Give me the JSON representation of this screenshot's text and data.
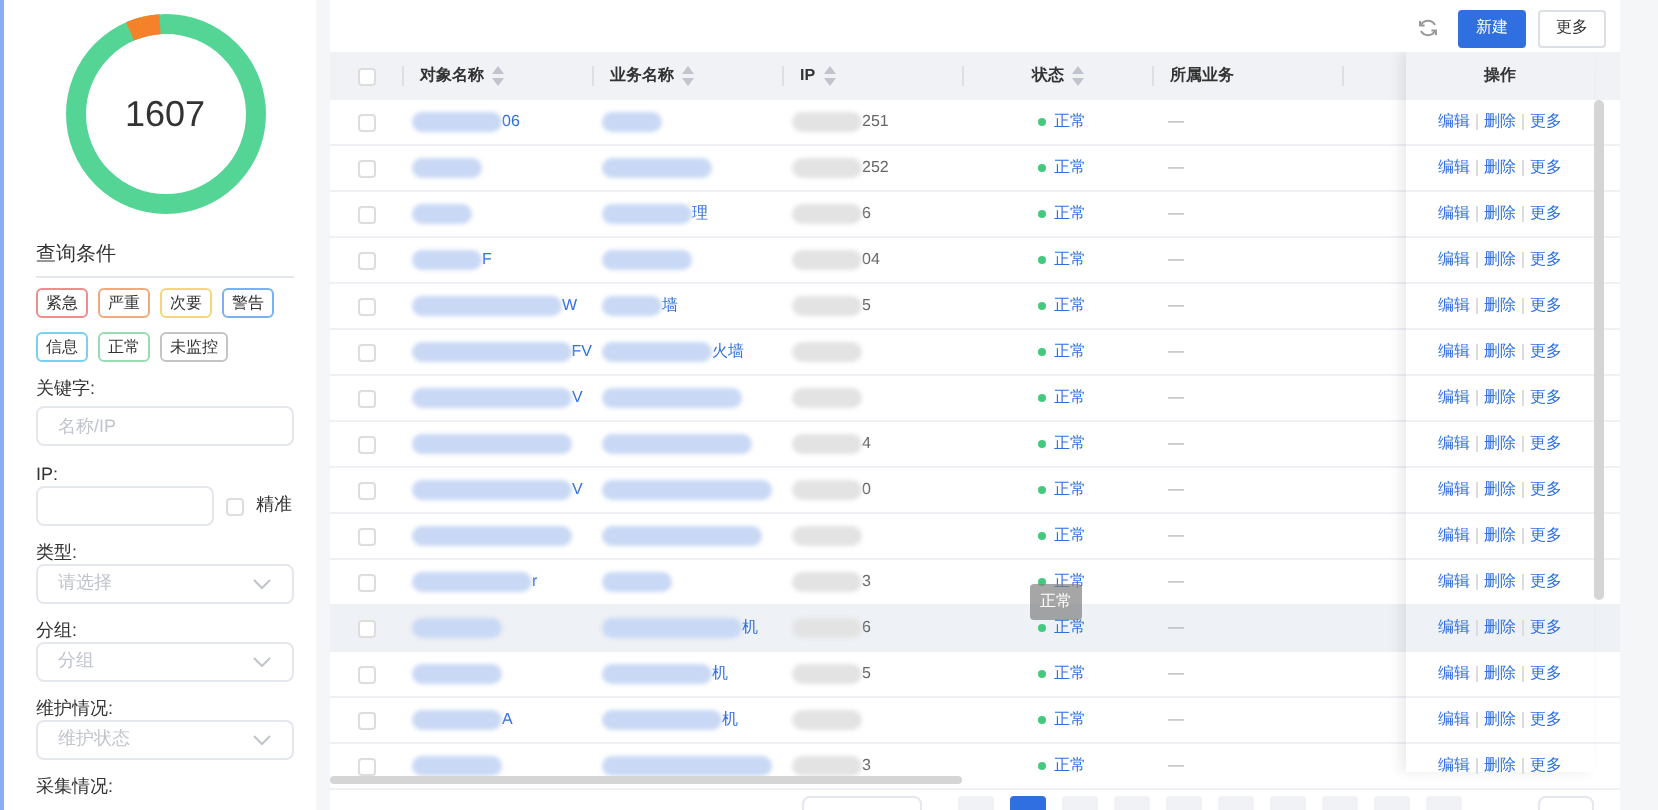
{
  "summary": {
    "total": "1607"
  },
  "filters": {
    "title": "查询条件",
    "levels": [
      {
        "label": "紧急",
        "color": "#f08c8c"
      },
      {
        "label": "严重",
        "color": "#f5a97a"
      },
      {
        "label": "次要",
        "color": "#f5d67a"
      },
      {
        "label": "警告",
        "color": "#7ab0f5"
      },
      {
        "label": "信息",
        "color": "#7ad0f0"
      },
      {
        "label": "正常",
        "color": "#9adbb4"
      },
      {
        "label": "未监控",
        "color": "#c4c4c4"
      }
    ],
    "keyword": {
      "label": "关键字:",
      "placeholder": "名称/IP"
    },
    "ip": {
      "label": "IP:",
      "exact_label": "精准",
      "checked": false
    },
    "type": {
      "label": "类型:",
      "placeholder": "请选择"
    },
    "group": {
      "label": "分组:",
      "placeholder": "分组"
    },
    "maintenance": {
      "label": "维护情况:",
      "placeholder": "维护状态"
    },
    "collection": {
      "label": "采集情况:"
    }
  },
  "toolbar": {
    "new": "新建",
    "more": "更多"
  },
  "table": {
    "columns": [
      "对象名称",
      "业务名称",
      "IP",
      "状态",
      "所属业务",
      "操作"
    ],
    "select_all": {
      "checked": false
    },
    "rows": [
      {
        "checked": false,
        "name": "06",
        "ip": "251",
        "status": "正常",
        "business": "—",
        "highlighted": false,
        "actions": [
          "编辑",
          "删除",
          "更多"
        ]
      },
      {
        "checked": false,
        "ip": "252",
        "status": "正常",
        "business": "—",
        "highlighted": false,
        "actions": [
          "编辑",
          "删除",
          "更多"
        ]
      },
      {
        "checked": false,
        "service": "理",
        "ip": "6",
        "status": "正常",
        "business": "—",
        "highlighted": false,
        "actions": [
          "编辑",
          "删除",
          "更多"
        ]
      },
      {
        "checked": false,
        "name": "F",
        "ip": "04",
        "status": "正常",
        "business": "—",
        "highlighted": false,
        "actions": [
          "编辑",
          "删除",
          "更多"
        ]
      },
      {
        "checked": false,
        "name": "W",
        "service": "墙",
        "ip": "5",
        "status": "正常",
        "business": "—",
        "highlighted": false,
        "actions": [
          "编辑",
          "删除",
          "更多"
        ]
      },
      {
        "checked": false,
        "name": "FV",
        "service": "火墙",
        "status": "正常",
        "business": "—",
        "highlighted": false,
        "actions": [
          "编辑",
          "删除",
          "更多"
        ]
      },
      {
        "checked": false,
        "name": "V",
        "status": "正常",
        "business": "—",
        "highlighted": false,
        "actions": [
          "编辑",
          "删除",
          "更多"
        ]
      },
      {
        "checked": false,
        "ip": "4",
        "status": "正常",
        "business": "—",
        "highlighted": false,
        "actions": [
          "编辑",
          "删除",
          "更多"
        ]
      },
      {
        "checked": false,
        "name": "V",
        "ip": "0",
        "status": "正常",
        "business": "—",
        "highlighted": false,
        "actions": [
          "编辑",
          "删除",
          "更多"
        ]
      },
      {
        "checked": false,
        "status": "正常",
        "business": "—",
        "highlighted": false,
        "actions": [
          "编辑",
          "删除",
          "更多"
        ]
      },
      {
        "checked": false,
        "name": "r",
        "ip": "3",
        "status": "正常",
        "business": "—",
        "highlighted": false,
        "actions": [
          "编辑",
          "删除",
          "更多"
        ]
      },
      {
        "checked": false,
        "service": "机",
        "ip": "6",
        "status": "正常",
        "business": "—",
        "highlighted": true,
        "tooltip": "正常",
        "actions": [
          "编辑",
          "删除",
          "更多"
        ]
      },
      {
        "checked": false,
        "service": "机",
        "ip": "5",
        "status": "正常",
        "business": "—",
        "highlighted": false,
        "actions": [
          "编辑",
          "删除",
          "更多"
        ]
      },
      {
        "checked": false,
        "name": "A",
        "service": "机",
        "status": "正常",
        "business": "—",
        "highlighted": false,
        "actions": [
          "编辑",
          "删除",
          "更多"
        ]
      },
      {
        "checked": false,
        "ip": "3",
        "status": "正常",
        "business": "—",
        "highlighted": false,
        "actions": [
          "编辑",
          "删除",
          "更多"
        ]
      }
    ]
  },
  "pagination": {
    "pages": [
      {
        "selected": false
      },
      {
        "selected": true
      },
      {
        "selected": false
      },
      {
        "selected": false
      },
      {
        "selected": false
      },
      {
        "selected": false
      },
      {
        "selected": false
      },
      {
        "selected": false
      },
      {
        "selected": false
      },
      {
        "selected": false
      }
    ]
  }
}
